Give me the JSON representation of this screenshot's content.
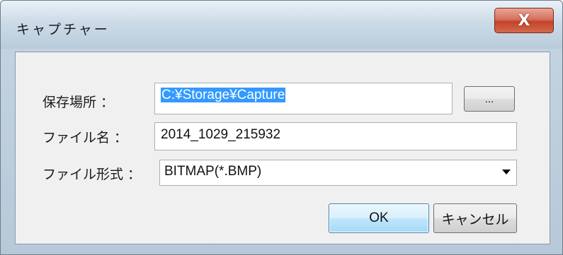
{
  "window": {
    "title": "キャプチャー",
    "close_label": "X"
  },
  "form": {
    "save_location": {
      "label": "保存場所 ：",
      "value": "C:¥Storage¥Capture",
      "browse_label": "..."
    },
    "file_name": {
      "label": "ファイル名 ：",
      "value": "2014_1029_215932"
    },
    "file_format": {
      "label": "ファイル形式 ：",
      "selected": "BITMAP(*.BMP)"
    }
  },
  "buttons": {
    "ok_label": "OK",
    "cancel_label": "キャンセル"
  },
  "colors": {
    "selection": "#3399ff",
    "close_button": "#c4432a",
    "default_button_border": "#3c7fb1"
  }
}
